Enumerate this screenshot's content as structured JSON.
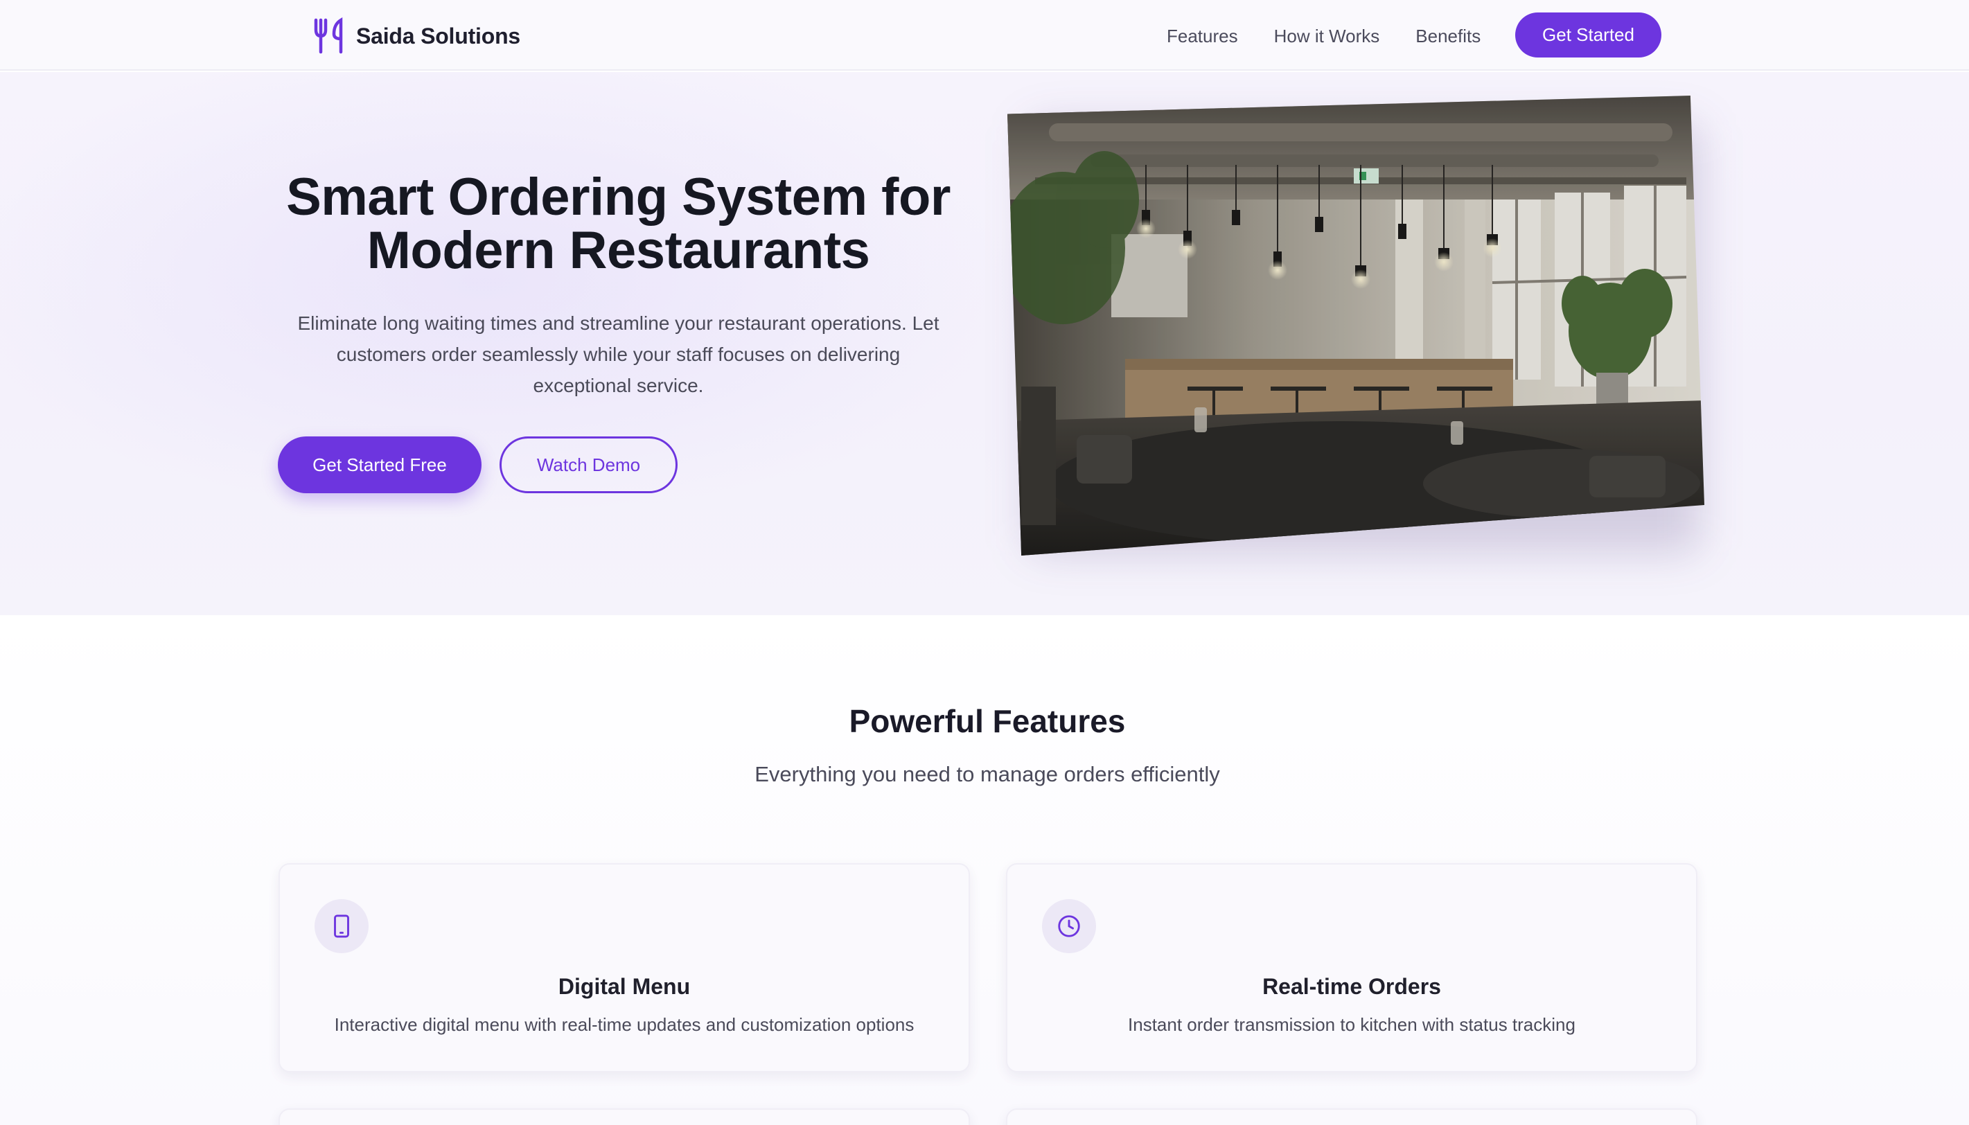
{
  "nav": {
    "brand": "Saida Solutions",
    "brand_icon": "fork-knife-icon",
    "links": [
      "Features",
      "How it Works",
      "Benefits"
    ],
    "cta": "Get Started"
  },
  "hero": {
    "title_line1": "Smart Ordering System for",
    "title_line2": "Modern Restaurants",
    "subtitle_line1": "Eliminate long waiting times and streamline your restaurant operations. Let",
    "subtitle_line2": "customers order seamlessly while your staff focuses on delivering",
    "subtitle_line3": "exceptional service.",
    "primary_button": "Get Started Free",
    "secondary_button": "Watch Demo"
  },
  "features": {
    "title": "Powerful Features",
    "subtitle": "Everything you need to manage orders efficiently",
    "cards": [
      {
        "icon": "tablet-icon",
        "title": "Digital Menu",
        "description": "Interactive digital menu with real-time updates and customization options"
      },
      {
        "icon": "clock-icon",
        "title": "Real-time Orders",
        "description": "Instant order transmission to kitchen with status tracking"
      }
    ]
  },
  "colors": {
    "accent": "#6d35df",
    "text_dark": "#161822",
    "text_muted": "#4a4a58",
    "hero_bg": "#f5f2fb"
  }
}
